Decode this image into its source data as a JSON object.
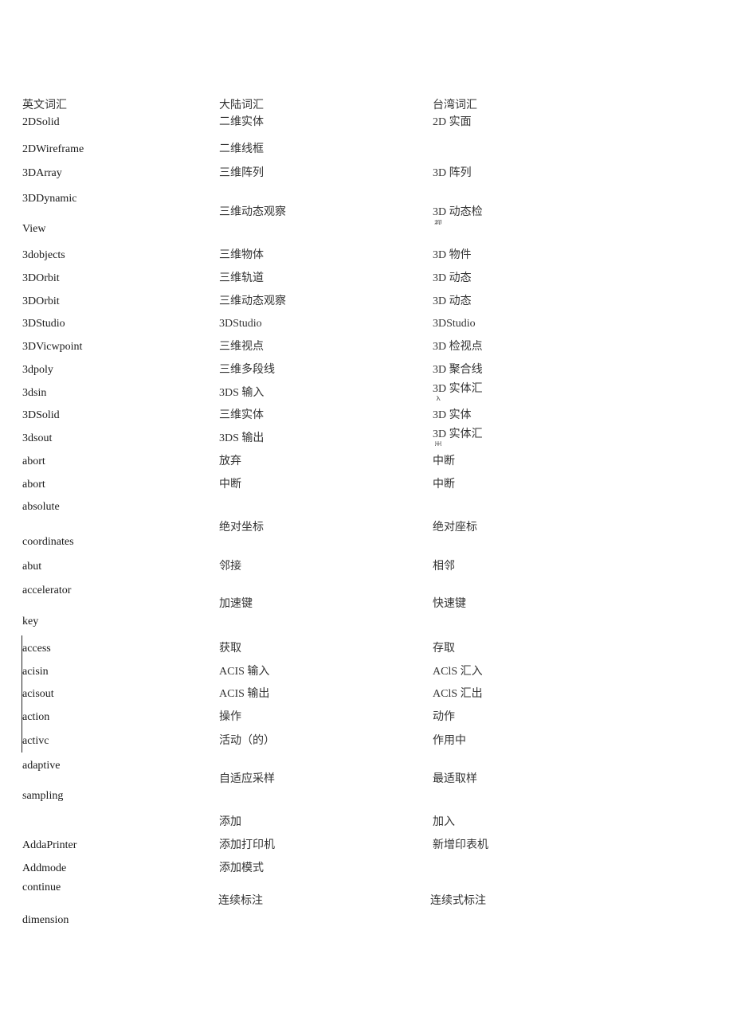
{
  "header": {
    "english": "英文词汇",
    "mainland": "大陆词汇",
    "taiwan": "台湾词汇"
  },
  "rows": [
    {
      "en": "2DSolid",
      "cn": "二维实体",
      "tw": "2D 实面"
    },
    {
      "en": "2DWireframe",
      "cn": "二维线框",
      "tw": ""
    },
    {
      "en": "3DArray",
      "cn": "三维阵列",
      "tw": "3D 阵列"
    },
    {
      "en": "3DDynamic",
      "en2": "View",
      "cn": "三维动态观察",
      "tw": "3D 动态检",
      "tw2": "视"
    },
    {
      "en": "3dobjects",
      "cn": "三维物体",
      "tw": "3D 物件"
    },
    {
      "en": "3DOrbit",
      "cn": "三维轨道",
      "tw": "3D 动态"
    },
    {
      "en": "3DOrbit",
      "cn": "三维动态观察",
      "tw": "3D 动态"
    },
    {
      "en": "3DStudio",
      "cn": "3DStudio",
      "tw": "3DStudio"
    },
    {
      "en": "3DVicwpoint",
      "cn": "三维视点",
      "tw": "3D 检视点"
    },
    {
      "en": "3dpoly",
      "cn": "三维多段线",
      "tw": "3D 聚合线"
    },
    {
      "en": "3dsin",
      "cn": "3DS 输入",
      "tw": "3D 实体汇",
      "tw2": "入"
    },
    {
      "en": "3DSolid",
      "cn": "三维实体",
      "tw": "3D 实体"
    },
    {
      "en": "3dsout",
      "cn": "3DS 输出",
      "tw": "3D 实体汇",
      "tw2": "出"
    },
    {
      "en": "abort",
      "cn": "放弃",
      "tw": "中断"
    },
    {
      "en": "abort",
      "cn": "中断",
      "tw": "中断"
    },
    {
      "en": "absolute",
      "en2": "coordinates",
      "cn": "绝对坐标",
      "tw": "绝对座标"
    },
    {
      "en": "abut",
      "cn": "邻接",
      "tw": "相邻"
    },
    {
      "en": "accelerator",
      "en2": "key",
      "cn": "加速键",
      "tw": "快速键"
    },
    {
      "en": "access",
      "cn": "获取",
      "tw": "存取"
    },
    {
      "en": "acisin",
      "cn": "ACIS 输入",
      "tw": "AClS 汇入"
    },
    {
      "en": "acisout",
      "cn": "ACIS 输出",
      "tw": "AClS 汇出"
    },
    {
      "en": "action",
      "cn": "操作",
      "tw": "动作"
    },
    {
      "en": "activc",
      "cn": "活动（的）",
      "tw": "作用中"
    },
    {
      "en": "adaptive",
      "en2": "sampling",
      "cn": "自适应采样",
      "tw": "最适取样"
    },
    {
      "en": "",
      "cn": "添加",
      "tw": "加入"
    },
    {
      "en": "AddaPrinter",
      "cn": "添加打印机",
      "tw": "新增印表机"
    },
    {
      "en": "Addmode",
      "cn": "添加模式",
      "tw": ""
    },
    {
      "en": "continue",
      "en2": "dimension",
      "cn": "连续标注",
      "tw": "连续式标注"
    }
  ]
}
